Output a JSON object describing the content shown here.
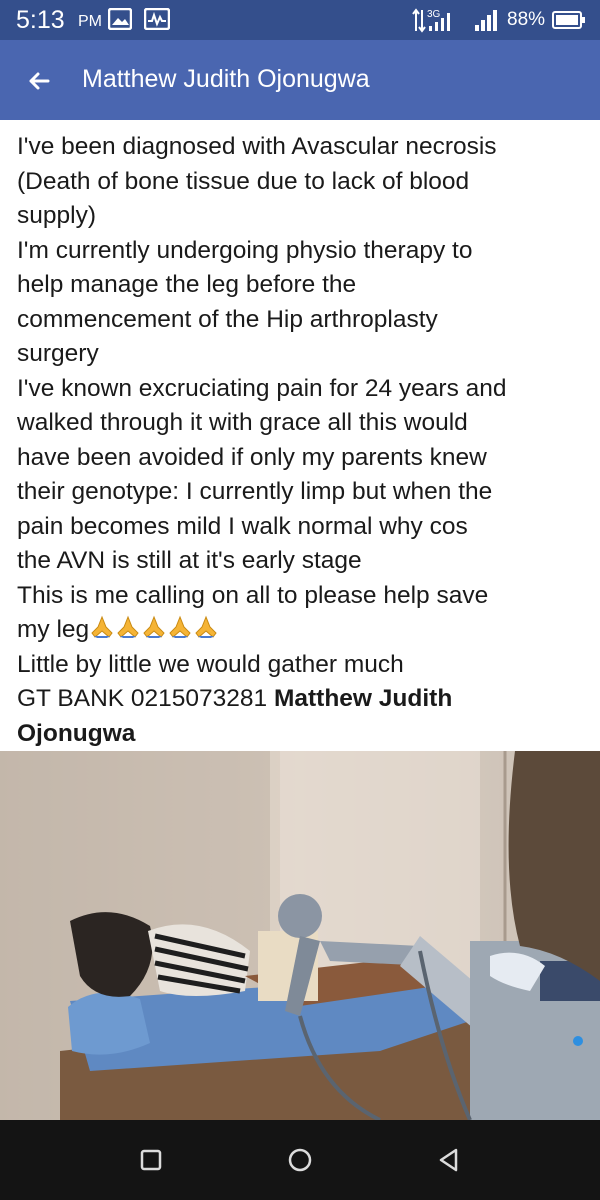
{
  "status_bar": {
    "time": "5:13",
    "ampm": "PM",
    "network_type": "3G",
    "battery_percent": "88%",
    "icons": [
      "image-icon",
      "activity-icon",
      "data-transfer-icon",
      "signal-icon",
      "battery-icon"
    ]
  },
  "header": {
    "back_icon": "back-arrow-icon",
    "title": "Matthew Judith Ojonugwa"
  },
  "post": {
    "lines": [
      "I've been diagnosed with Avascular necrosis",
      "(Death of bone tissue due to lack of blood",
      "supply)",
      "I'm currently undergoing physio therapy to",
      "help manage the leg before the",
      "commencement of the Hip arthroplasty",
      "surgery",
      "I've known excruciating pain for 24 years and",
      "walked through it with grace all this would",
      "have been avoided if only my parents knew",
      "their genotype: I currently limp but when the",
      "pain becomes mild I walk normal why cos",
      "the AVN is still at it's early stage",
      "This is me calling on all to please help save",
      "my leg",
      "Little by little we would gather much"
    ],
    "prayer_emoji_count": 5,
    "bank_line": "GT BANK 0215073281",
    "account_name_line1": "Matthew Judith",
    "account_name_line2": "Ojonugwa"
  },
  "photo": {
    "icon": "photo-physiotherapy-image"
  },
  "nav_bar": {
    "icons": [
      "recents-square-icon",
      "home-circle-icon",
      "back-triangle-icon"
    ]
  },
  "colors": {
    "status_bar": "#344f8c",
    "header": "#4a66b0",
    "text": "#1a1a1a",
    "nav_bar": "#141414"
  }
}
